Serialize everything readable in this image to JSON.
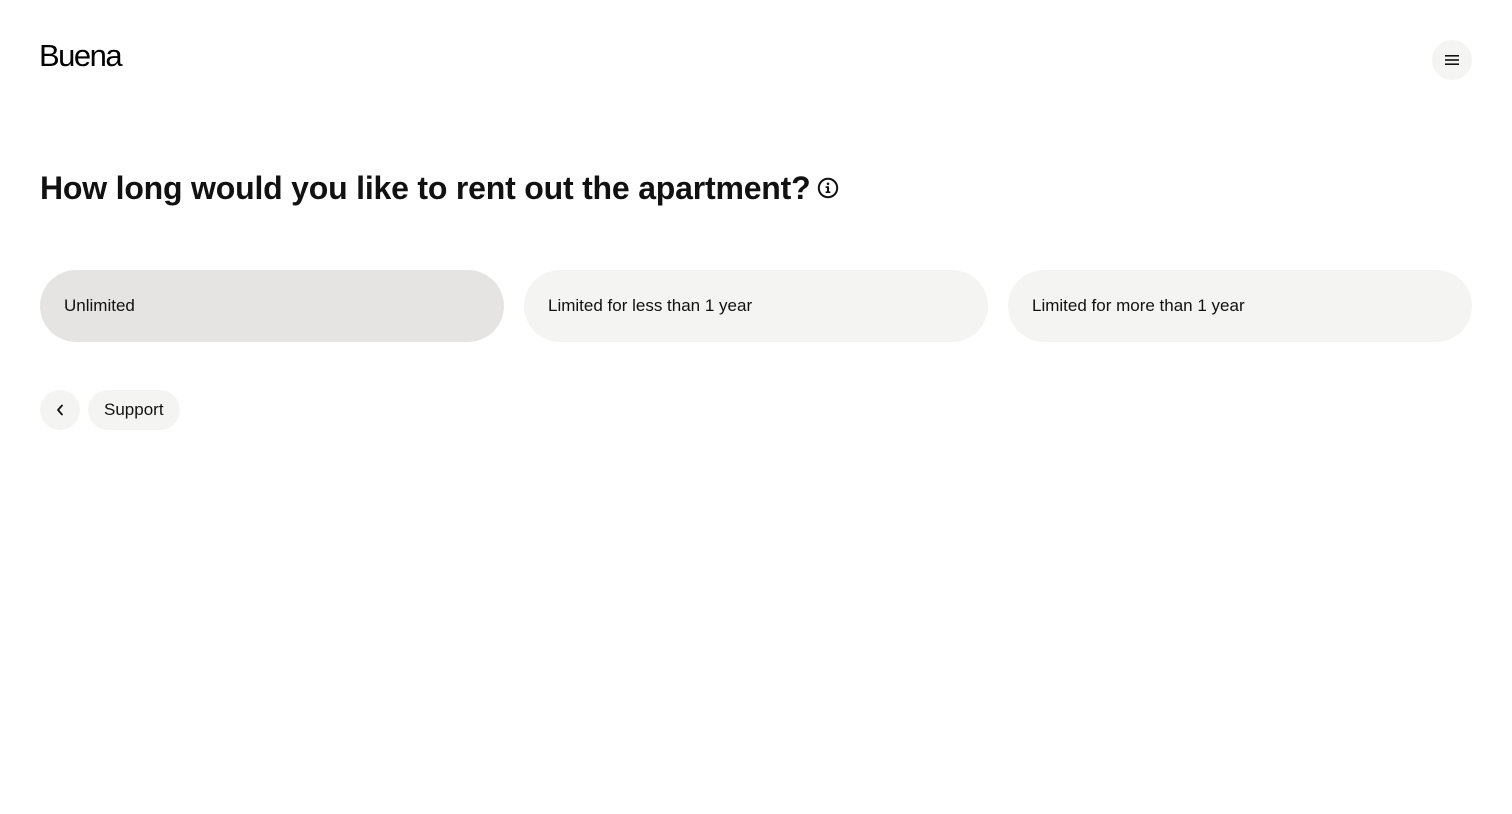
{
  "header": {
    "logo_text": "Buena",
    "menu_icon": "hamburger-menu-icon"
  },
  "question": {
    "title": "How long would you like to rent out the apartment?",
    "info_icon": "info-icon"
  },
  "options": [
    {
      "label": "Unlimited",
      "selected": true
    },
    {
      "label": "Limited for less than 1 year",
      "selected": false
    },
    {
      "label": "Limited for more than 1 year",
      "selected": false
    }
  ],
  "footer": {
    "back_icon": "chevron-left-icon",
    "support_label": "Support"
  },
  "colors": {
    "background": "#ffffff",
    "option_default": "#f4f4f2",
    "option_selected": "#e5e4e2",
    "text": "#111111"
  }
}
